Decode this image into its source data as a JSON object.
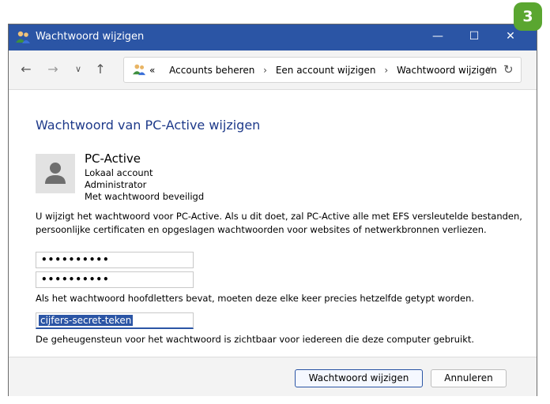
{
  "window": {
    "title": "Wachtwoord wijzigen",
    "minimize_glyph": "—",
    "maximize_glyph": "☐",
    "close_glyph": "✕"
  },
  "nav": {
    "back_glyph": "←",
    "forward_glyph": "→",
    "recent_glyph": "∨",
    "up_glyph": "↑",
    "overflow": "«",
    "breadcrumbs": [
      "Accounts beheren",
      "Een account wijzigen",
      "Wachtwoord wijzigen"
    ],
    "separator": "›",
    "dropdown_glyph": "∨",
    "refresh_glyph": "↻"
  },
  "page": {
    "title": "Wachtwoord van PC-Active wijzigen",
    "account": {
      "name": "PC-Active",
      "type": "Lokaal account",
      "role": "Administrator",
      "protection": "Met wachtwoord beveiligd"
    },
    "info": "U wijzigt het wachtwoord voor PC-Active. Als u dit doet, zal PC-Active alle met EFS versleutelde bestanden, persoonlijke certificaten en opgeslagen wachtwoorden voor websites of netwerkbronnen verliezen.",
    "new_password": "••••••••••",
    "confirm_password": "••••••••••",
    "case_note": "Als het wachtwoord hoofdletters bevat, moeten deze elke keer precies hetzelfde getypt worden.",
    "hint_value": "cijfers-secret-teken",
    "hint_note": "De geheugensteun voor het wachtwoord is zichtbaar voor iedereen die deze computer gebruikt."
  },
  "buttons": {
    "change": "Wachtwoord wijzigen",
    "cancel": "Annuleren"
  },
  "badge": "3",
  "icons": {
    "app": "users-icon",
    "avatar": "user-avatar-icon"
  },
  "colors": {
    "titlebar": "#2b55a5",
    "title_text": "#1e3a8a",
    "badge": "#5aa630"
  }
}
